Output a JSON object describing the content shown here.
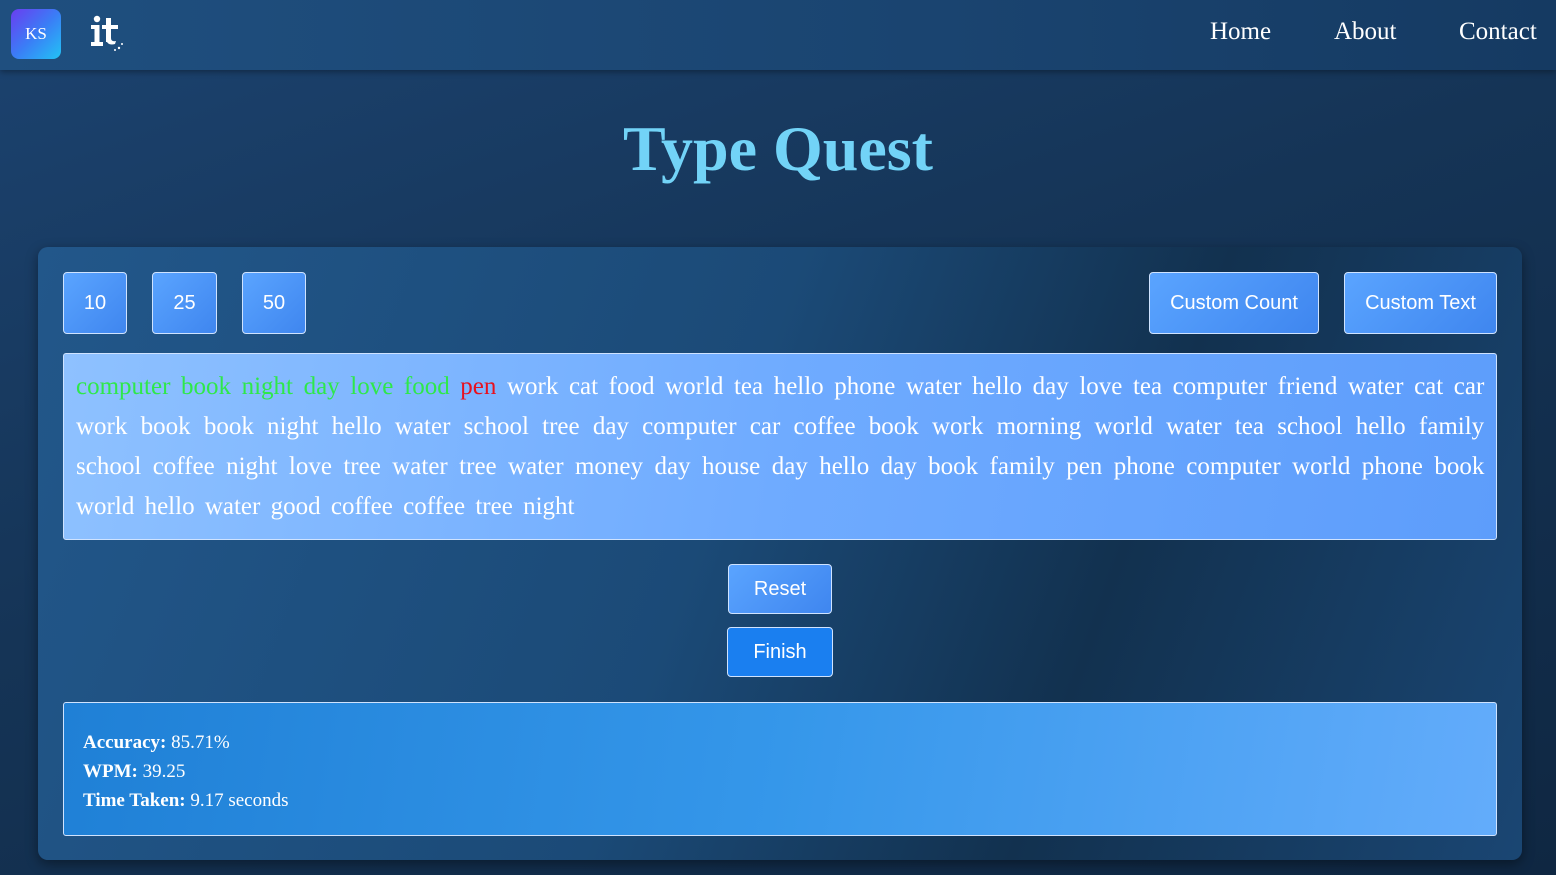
{
  "nav": {
    "logo_text": "KS",
    "links": [
      "Home",
      "About",
      "Contact"
    ]
  },
  "title": "Type Quest",
  "word_count_buttons": [
    "10",
    "25",
    "50"
  ],
  "custom_buttons": {
    "count": "Custom Count",
    "text": "Custom Text"
  },
  "words": [
    {
      "t": "computer",
      "s": "correct"
    },
    {
      "t": "book",
      "s": "correct"
    },
    {
      "t": "night",
      "s": "correct"
    },
    {
      "t": "day",
      "s": "correct"
    },
    {
      "t": "love",
      "s": "correct"
    },
    {
      "t": "food",
      "s": "correct"
    },
    {
      "t": "pen",
      "s": "wrong"
    },
    {
      "t": "work",
      "s": ""
    },
    {
      "t": "cat",
      "s": ""
    },
    {
      "t": "food",
      "s": ""
    },
    {
      "t": "world",
      "s": ""
    },
    {
      "t": "tea",
      "s": ""
    },
    {
      "t": "hello",
      "s": ""
    },
    {
      "t": "phone",
      "s": ""
    },
    {
      "t": "water",
      "s": ""
    },
    {
      "t": "hello",
      "s": ""
    },
    {
      "t": "day",
      "s": ""
    },
    {
      "t": "love",
      "s": ""
    },
    {
      "t": "tea",
      "s": ""
    },
    {
      "t": "computer",
      "s": ""
    },
    {
      "t": "friend",
      "s": ""
    },
    {
      "t": "water",
      "s": ""
    },
    {
      "t": "cat",
      "s": ""
    },
    {
      "t": "car",
      "s": ""
    },
    {
      "t": "work",
      "s": ""
    },
    {
      "t": "book",
      "s": ""
    },
    {
      "t": "book",
      "s": ""
    },
    {
      "t": "night",
      "s": ""
    },
    {
      "t": "hello",
      "s": ""
    },
    {
      "t": "water",
      "s": ""
    },
    {
      "t": "school",
      "s": ""
    },
    {
      "t": "tree",
      "s": ""
    },
    {
      "t": "day",
      "s": ""
    },
    {
      "t": "computer",
      "s": ""
    },
    {
      "t": "car",
      "s": ""
    },
    {
      "t": "coffee",
      "s": ""
    },
    {
      "t": "book",
      "s": ""
    },
    {
      "t": "work",
      "s": ""
    },
    {
      "t": "morning",
      "s": ""
    },
    {
      "t": "world",
      "s": ""
    },
    {
      "t": "water",
      "s": ""
    },
    {
      "t": "tea",
      "s": ""
    },
    {
      "t": "school",
      "s": ""
    },
    {
      "t": "hello",
      "s": ""
    },
    {
      "t": "family",
      "s": ""
    },
    {
      "t": "school",
      "s": ""
    },
    {
      "t": "coffee",
      "s": ""
    },
    {
      "t": "night",
      "s": ""
    },
    {
      "t": "love",
      "s": ""
    },
    {
      "t": "tree",
      "s": ""
    },
    {
      "t": "water",
      "s": ""
    },
    {
      "t": "tree",
      "s": ""
    },
    {
      "t": "water",
      "s": ""
    },
    {
      "t": "money",
      "s": ""
    },
    {
      "t": "day",
      "s": ""
    },
    {
      "t": "house",
      "s": ""
    },
    {
      "t": "day",
      "s": ""
    },
    {
      "t": "hello",
      "s": ""
    },
    {
      "t": "day",
      "s": ""
    },
    {
      "t": "book",
      "s": ""
    },
    {
      "t": "family",
      "s": ""
    },
    {
      "t": "pen",
      "s": ""
    },
    {
      "t": "phone",
      "s": ""
    },
    {
      "t": "computer",
      "s": ""
    },
    {
      "t": "world",
      "s": ""
    },
    {
      "t": "phone",
      "s": ""
    },
    {
      "t": "book",
      "s": ""
    },
    {
      "t": "world",
      "s": ""
    },
    {
      "t": "hello",
      "s": ""
    },
    {
      "t": "water",
      "s": ""
    },
    {
      "t": "good",
      "s": ""
    },
    {
      "t": "coffee",
      "s": ""
    },
    {
      "t": "coffee",
      "s": ""
    },
    {
      "t": "tree",
      "s": ""
    },
    {
      "t": "night",
      "s": ""
    }
  ],
  "actions": {
    "reset": "Reset",
    "finish": "Finish"
  },
  "stats": {
    "accuracy_label": "Accuracy:",
    "accuracy_value": "85.71%",
    "wpm_label": "WPM:",
    "wpm_value": "39.25",
    "time_label": "Time Taken:",
    "time_value": "9.17 seconds"
  },
  "colors": {
    "correct": "#2ee84a",
    "wrong": "#e8101e",
    "title": "#72d3f7",
    "finish_button": "#1a7ff0"
  }
}
